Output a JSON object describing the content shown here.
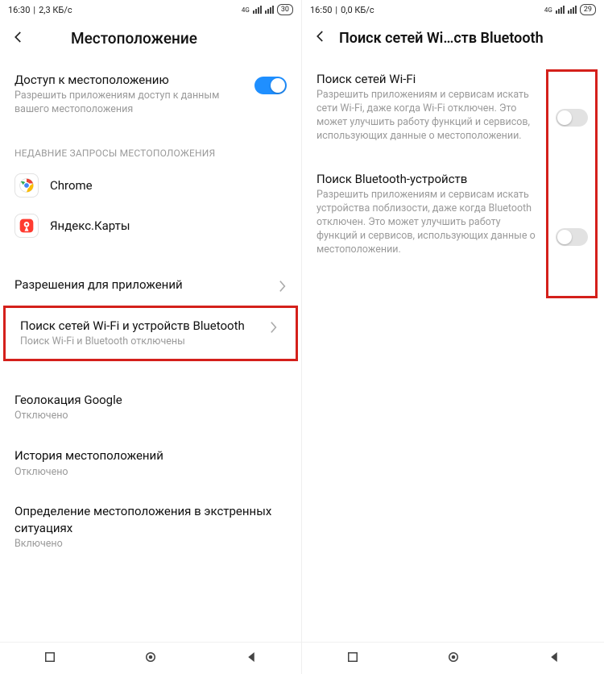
{
  "left": {
    "status": {
      "time": "16:30",
      "data": "2,3 КБ/с",
      "net": "4G",
      "battery": "30"
    },
    "title": "Местоположение",
    "access": {
      "title": "Доступ к местоположению",
      "subtitle": "Разрешить приложениям доступ к данным вашего местоположения"
    },
    "recent_label": "НЕДАВНИЕ ЗАПРОСЫ МЕСТОПОЛОЖЕНИЯ",
    "apps": [
      {
        "name": "Chrome"
      },
      {
        "name": "Яндекс.Карты"
      }
    ],
    "perm": {
      "title": "Разрешения для приложений"
    },
    "scan": {
      "title": "Поиск сетей Wi-Fi и устройств Bluetooth",
      "subtitle": "Поиск Wi-Fi и Bluetooth отключены"
    },
    "google": {
      "title": "Геолокация Google",
      "subtitle": "Отключено"
    },
    "history": {
      "title": "История местоположений",
      "subtitle": "Отключено"
    },
    "emergency": {
      "title": "Определение местоположения в экстренных ситуациях",
      "subtitle": "Включено"
    }
  },
  "right": {
    "status": {
      "time": "16:50",
      "data": "0,0 КБ/с",
      "net": "4G",
      "battery": "29"
    },
    "title": "Поиск сетей Wi…ств Bluetooth",
    "wifi": {
      "title": "Поиск сетей Wi-Fi",
      "subtitle": "Разрешить приложениям и сервисам искать сети Wi-Fi, даже когда Wi-Fi отключен. Это может улучшить работу функций и сервисов, использующих данные о местоположении."
    },
    "bt": {
      "title": "Поиск Bluetooth-устройств",
      "subtitle": "Разрешить приложениям и сервисам искать устройства поблизости, даже когда Bluetooth отключен. Это может улучшить работу функций и сервисов, использующих данные о местоположении."
    }
  }
}
